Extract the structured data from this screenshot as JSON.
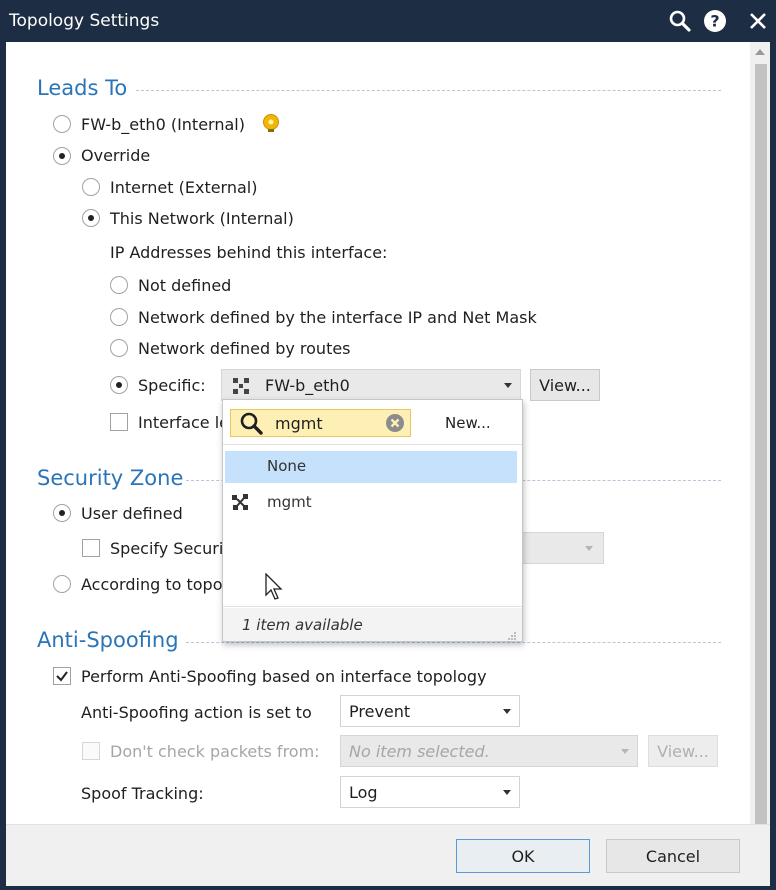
{
  "window": {
    "title": "Topology Settings",
    "icons": [
      "search-icon",
      "help-icon",
      "close-icon"
    ]
  },
  "leads_to": {
    "title": "Leads To",
    "option_interface": "FW-b_eth0 (Internal)",
    "option_override": "Override",
    "internet_external": "Internet (External)",
    "this_network_internal": "This Network (Internal)",
    "ip_addresses_label": "IP Addresses behind this interface:",
    "not_defined": "Not defined",
    "network_by_ip_mask": "Network defined by the interface IP and Net Mask",
    "network_by_routes": "Network defined by routes",
    "specific_label": "Specific:",
    "specific_value": "FW-b_eth0",
    "view_label": "View...",
    "interface_leads_truncated": "Interface le"
  },
  "security_zone": {
    "title": "Security Zone",
    "user_defined": "User defined",
    "specify_security_truncated": "Specify Securi",
    "according_to_topology_truncated": "According to topo"
  },
  "anti_spoofing": {
    "title": "Anti-Spoofing",
    "perform_label": "Perform Anti-Spoofing based on interface topology",
    "action_label": "Anti-Spoofing action is set to",
    "action_value": "Prevent",
    "dont_check_label": "Don't check packets from:",
    "dont_check_placeholder": "No item selected.",
    "view_label": "View...",
    "spoof_tracking_label": "Spoof Tracking:",
    "spoof_tracking_value": "Log"
  },
  "dropdown": {
    "search_value": "mgmt",
    "new_label": "New...",
    "items": [
      "None",
      "mgmt"
    ],
    "footer": "1 item available"
  },
  "footer": {
    "ok_label": "OK",
    "cancel_label": "Cancel"
  },
  "colors": {
    "titlebar": "#1d2d44",
    "section_title": "#2b74b8",
    "selected_row": "#c5e1fb",
    "search_highlight": "#fef0b5"
  }
}
